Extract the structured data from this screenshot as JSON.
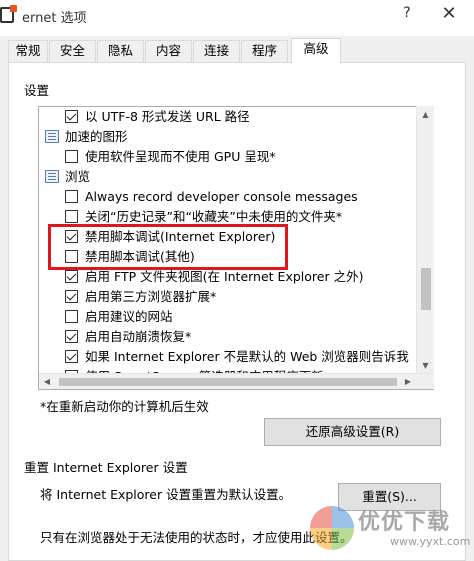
{
  "window": {
    "title": "ernet 选项",
    "help_glyph": "?",
    "close_glyph": "✕"
  },
  "tabs": [
    {
      "label": "常规"
    },
    {
      "label": "安全"
    },
    {
      "label": "隐私"
    },
    {
      "label": "内容"
    },
    {
      "label": "连接"
    },
    {
      "label": "程序"
    },
    {
      "label": "高级",
      "active": true
    }
  ],
  "settings": {
    "group_label": "设置",
    "items": [
      {
        "kind": "checkbox",
        "checked": true,
        "label": "以 UTF-8 形式发送 URL 路径"
      },
      {
        "kind": "category",
        "label": "加速的图形"
      },
      {
        "kind": "checkbox",
        "checked": false,
        "label": "使用软件呈现而不使用 GPU 呈现*"
      },
      {
        "kind": "category",
        "label": "浏览"
      },
      {
        "kind": "checkbox",
        "checked": false,
        "label": "Always record developer console messages"
      },
      {
        "kind": "checkbox",
        "checked": false,
        "label": "关闭“历史记录”和“收藏夹”中未使用的文件夹*"
      },
      {
        "kind": "checkbox",
        "checked": true,
        "label": "禁用脚本调试(Internet Explorer)"
      },
      {
        "kind": "checkbox",
        "checked": false,
        "label": "禁用脚本调试(其他)"
      },
      {
        "kind": "checkbox",
        "checked": true,
        "label": "启用 FTP 文件夹视图(在 Internet Explorer 之外)"
      },
      {
        "kind": "checkbox",
        "checked": true,
        "label": "启用第三方浏览器扩展*"
      },
      {
        "kind": "checkbox",
        "checked": false,
        "label": "启用建议的网站"
      },
      {
        "kind": "checkbox",
        "checked": true,
        "label": "启用自动崩溃恢复*"
      },
      {
        "kind": "checkbox",
        "checked": true,
        "label": "如果 Internet Explorer 不是默认的 Web 浏览器则告诉我"
      },
      {
        "kind": "checkbox",
        "checked": true,
        "label": "使用 SmartScreen 筛选器和应用程序更新"
      }
    ],
    "scroll_up_glyph": "▲",
    "scroll_down_glyph": "▼",
    "scroll_left_glyph": "◀",
    "scroll_right_glyph": "▶"
  },
  "restart_note": "*在重新启动你的计算机后生效",
  "restore_button": "还原高级设置(R)",
  "reset": {
    "title": "重置 Internet Explorer 设置",
    "description": "将 Internet Explorer 设置重置为默认设置。",
    "button": "重置(S)...",
    "note": "只有在浏览器处于无法使用的状态时，才应使用此设置。"
  },
  "watermark": {
    "text": "优优下载",
    "url": "www.yyxt.com"
  },
  "colors": {
    "highlight_border": "#e0161e",
    "accent": "#e8541e"
  }
}
